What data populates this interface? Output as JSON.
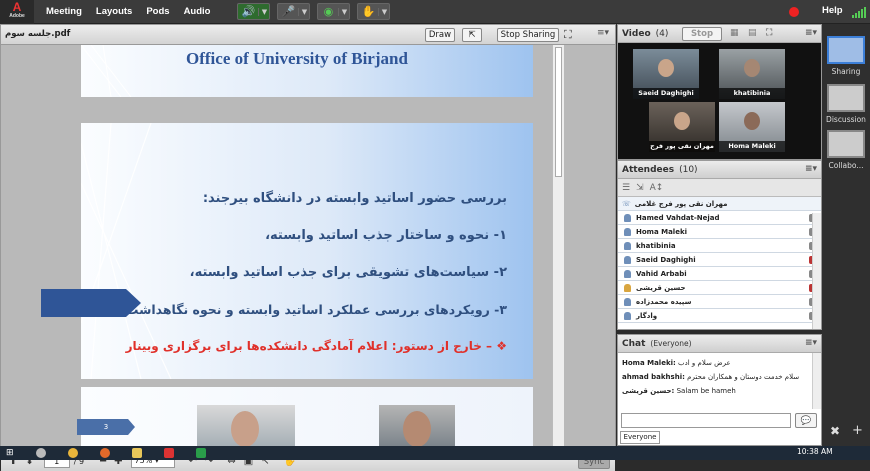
{
  "app": {
    "logo": "A",
    "logo_sub": "Adobe"
  },
  "menu": [
    "Meeting",
    "Layouts",
    "Pods",
    "Audio"
  ],
  "toolbar": {
    "help": "Help"
  },
  "share": {
    "filename": "جلسه سوم.pdf",
    "draw_label": "Draw",
    "stop_sharing_label": "Stop Sharing",
    "slide_title": "Office of University of Birjand",
    "slide_heading": "بررسی حضور اساتید وابسته در دانشگاه بیرجند:",
    "items": [
      "۱- نحوه و ساختار جذب اساتید وابسته،",
      "۲- سیاست‌های تشویقی برای جذب اساتید وابسته،",
      "۳- رویکردهای بررسی عملکرد اساتید وابسته و نحوه نگاهداشت آنها"
    ],
    "item_bullet": "❖",
    "item_red": "– خارج از دستور: اعلام آمادگی دانشکده‌ها برای برگزاری وبینار",
    "next_slide_number": "3",
    "page_current": "1",
    "page_total": "/ 9",
    "zoom": "75%",
    "sync_label": "Sync",
    "accent": "#2f5597"
  },
  "video": {
    "title": "Video",
    "count": "(4)",
    "stop_label": "Stop",
    "tiles": [
      "Saeid Daghighi",
      "khatibinia",
      "مهران نقی پور فرج",
      "Homa Maleki"
    ]
  },
  "attendees": {
    "title": "Attendees",
    "count": "(10)",
    "host": "مهران نقی پور فرج غلامی",
    "list": [
      "Hamed Vahdat-Nejad",
      "Homa Maleki",
      "khatibinia",
      "Saeid Daghighi",
      "Vahid Arbabi",
      "حسین قریشی",
      "سپیده محمدزاده",
      "وادگار"
    ]
  },
  "chat": {
    "title": "Chat",
    "scope": "(Everyone)",
    "messages": [
      {
        "name": "Homa Maleki:",
        "text": "عرض سلام و ادب"
      },
      {
        "name": "ahmad bakhshi:",
        "text": "سلام خدمت دوستان و همکاران محترم"
      },
      {
        "name": "حسین قریشی:",
        "text": "Salam be hameh"
      }
    ],
    "tab": "Everyone"
  },
  "layouts": [
    "Sharing",
    "Discussion",
    "Collabo..."
  ],
  "clock": "10:38 AM",
  "colors": {
    "accent": "#2f5597",
    "red_text": "#e0302a",
    "record": "#e22222"
  }
}
